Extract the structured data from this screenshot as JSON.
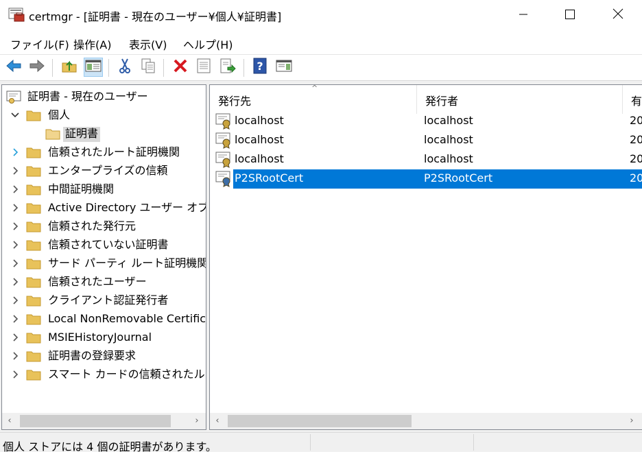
{
  "window": {
    "title": "certmgr - [証明書 - 現在のユーザー¥個人¥証明書]",
    "controls": {
      "minimize_icon": "minimize-icon",
      "maximize_icon": "maximize-icon",
      "close_icon": "close-icon"
    }
  },
  "menu": {
    "file": "ファイル(F)",
    "action": "操作(A)",
    "view": "表示(V)",
    "help": "ヘルプ(H)"
  },
  "toolbar": {
    "icons": [
      "back-arrow-icon",
      "forward-arrow-icon",
      "up-folder-icon",
      "show-hide-tree-icon",
      "cut-icon",
      "copy-icon",
      "delete-icon",
      "properties-icon",
      "export-list-icon",
      "help-icon",
      "show-action-pane-icon"
    ]
  },
  "tree": {
    "root_label": "証明書 - 現在のユーザー",
    "personal_label": "個人",
    "personal_child": "証明書",
    "items": [
      "信頼されたルート証明機関",
      "エンタープライズの信頼",
      "中間証明機関",
      "Active Directory ユーザー オブジェ",
      "信頼された発行元",
      "信頼されていない証明書",
      "サード パーティ ルート証明機関",
      "信頼されたユーザー",
      "クライアント認証発行者",
      "Local NonRemovable Certifica",
      "MSIEHistoryJournal",
      "証明書の登録要求",
      "スマート カードの信頼されたルート"
    ]
  },
  "list": {
    "columns": {
      "issued_to": "発行先",
      "issued_by": "発行者",
      "expires": "有"
    },
    "rows": [
      {
        "issued_to": "localhost",
        "issued_by": "localhost",
        "expires": "20"
      },
      {
        "issued_to": "localhost",
        "issued_by": "localhost",
        "expires": "20"
      },
      {
        "issued_to": "localhost",
        "issued_by": "localhost",
        "expires": "20"
      },
      {
        "issued_to": "P2SRootCert",
        "issued_by": "P2SRootCert",
        "expires": "20"
      }
    ],
    "selected_index": 3
  },
  "status": {
    "text": "個人 ストアには 4 個の証明書があります。"
  },
  "colors": {
    "selection": "#0078d7",
    "folder": "#e8c25a",
    "tree_selected": "#d9d9d9"
  }
}
